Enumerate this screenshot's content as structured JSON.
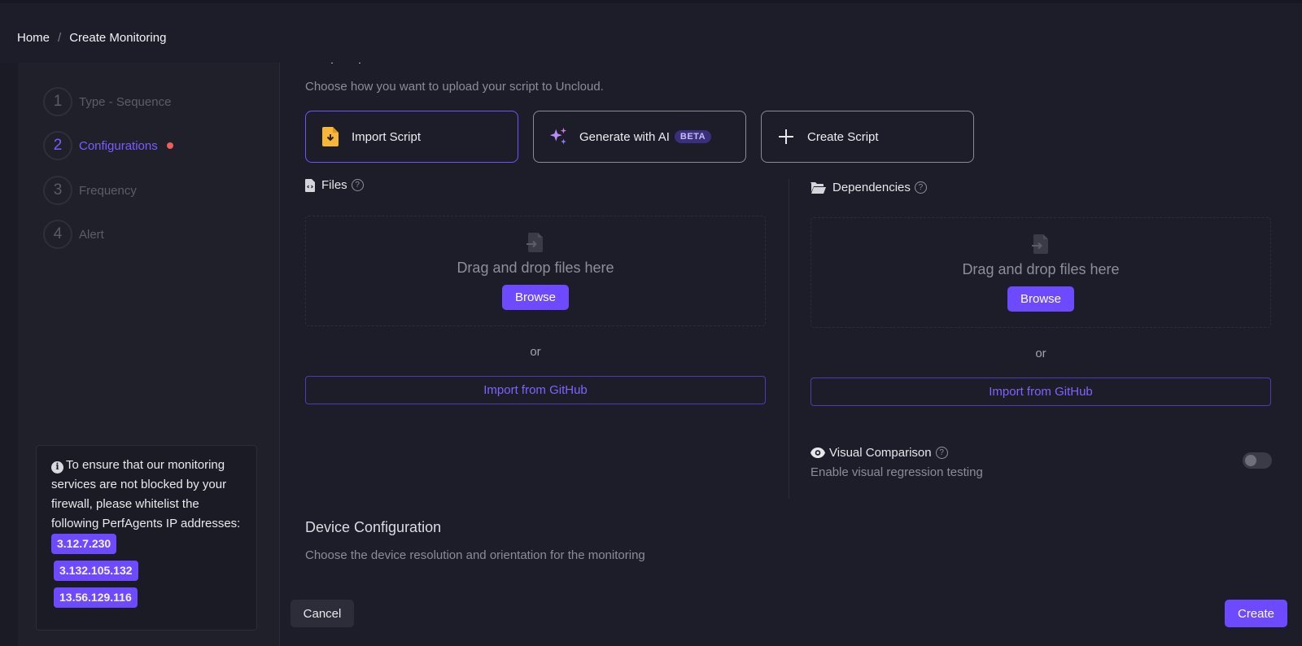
{
  "breadcrumb": {
    "home": "Home",
    "separator": "/",
    "current": "Create Monitoring"
  },
  "steps": [
    {
      "num": "1",
      "label": "Type - Sequence"
    },
    {
      "num": "2",
      "label": "Configurations"
    },
    {
      "num": "3",
      "label": "Frequency"
    },
    {
      "num": "4",
      "label": "Alert"
    }
  ],
  "whitelist": {
    "text": "To ensure that our monitoring services are not blocked by your firewall, please whitelist the following PerfAgents IP addresses:",
    "ips": [
      "3.12.7.230",
      "3.132.105.132",
      "13.56.129.116"
    ]
  },
  "script_options": {
    "title": "Script Options",
    "subtitle": "Choose how you want to upload your script to Uncloud.",
    "cards": {
      "import": "Import Script",
      "generate": "Generate with AI",
      "beta": "BETA",
      "create": "Create Script"
    }
  },
  "files": {
    "label": "Files",
    "drop_text": "Drag and drop files here",
    "browse": "Browse",
    "or": "or",
    "github": "Import from GitHub"
  },
  "dependencies": {
    "label": "Dependencies",
    "drop_text": "Drag and drop files here",
    "browse": "Browse",
    "or": "or",
    "github": "Import from GitHub"
  },
  "visual_comparison": {
    "label": "Visual Comparison",
    "description": "Enable visual regression testing",
    "enabled": false
  },
  "device_config": {
    "title": "Device Configuration",
    "subtitle": "Choose the device resolution and orientation for the monitoring"
  },
  "footer": {
    "cancel": "Cancel",
    "create": "Create"
  },
  "colors": {
    "accent": "#6d4aff",
    "background": "#1c1d28",
    "error_dot": "#f25c5c"
  }
}
